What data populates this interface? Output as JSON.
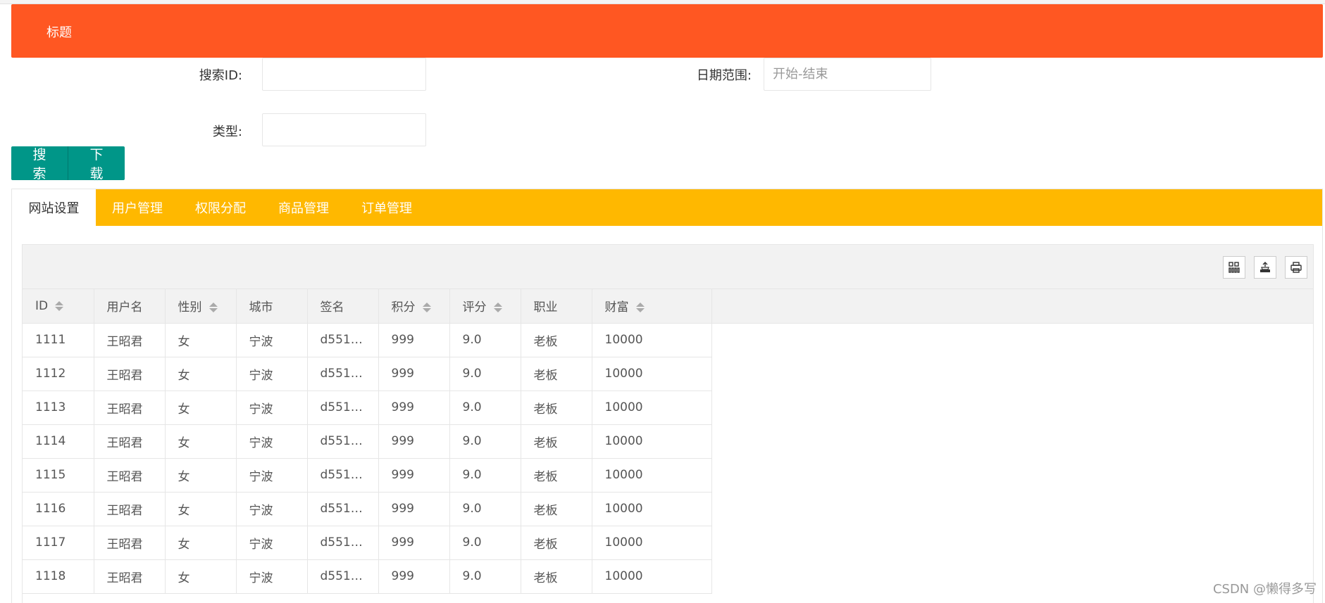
{
  "header": {
    "title": "标题"
  },
  "search_form": {
    "id_label": "搜索ID:",
    "id_value": "",
    "date_label": "日期范围:",
    "date_placeholder": "开始-结束",
    "type_label": "类型:",
    "type_value": ""
  },
  "buttons": {
    "search": "搜索",
    "download": "下载"
  },
  "tabs": [
    {
      "label": "网站设置",
      "active": true
    },
    {
      "label": "用户管理"
    },
    {
      "label": "权限分配"
    },
    {
      "label": "商品管理"
    },
    {
      "label": "订单管理"
    }
  ],
  "toolbar_icons": [
    "columns-icon",
    "export-icon",
    "print-icon"
  ],
  "table": {
    "columns": [
      "ID",
      "用户名",
      "性别",
      "城市",
      "签名",
      "积分",
      "评分",
      "职业",
      "财富"
    ],
    "sortable": [
      true,
      false,
      true,
      false,
      false,
      true,
      true,
      false,
      true
    ],
    "rows": [
      [
        "1111",
        "王昭君",
        "女",
        "宁波",
        "d551…",
        "999",
        "9.0",
        "老板",
        "10000"
      ],
      [
        "1112",
        "王昭君",
        "女",
        "宁波",
        "d551…",
        "999",
        "9.0",
        "老板",
        "10000"
      ],
      [
        "1113",
        "王昭君",
        "女",
        "宁波",
        "d551…",
        "999",
        "9.0",
        "老板",
        "10000"
      ],
      [
        "1114",
        "王昭君",
        "女",
        "宁波",
        "d551…",
        "999",
        "9.0",
        "老板",
        "10000"
      ],
      [
        "1115",
        "王昭君",
        "女",
        "宁波",
        "d551…",
        "999",
        "9.0",
        "老板",
        "10000"
      ],
      [
        "1116",
        "王昭君",
        "女",
        "宁波",
        "d551…",
        "999",
        "9.0",
        "老板",
        "10000"
      ],
      [
        "1117",
        "王昭君",
        "女",
        "宁波",
        "d551…",
        "999",
        "9.0",
        "老板",
        "10000"
      ],
      [
        "1118",
        "王昭君",
        "女",
        "宁波",
        "d551…",
        "999",
        "9.0",
        "老板",
        "10000"
      ]
    ]
  },
  "watermark": "CSDN @懒得多写",
  "colors": {
    "header": "#ff5722",
    "button": "#009688",
    "tabs": "#ffb800"
  }
}
